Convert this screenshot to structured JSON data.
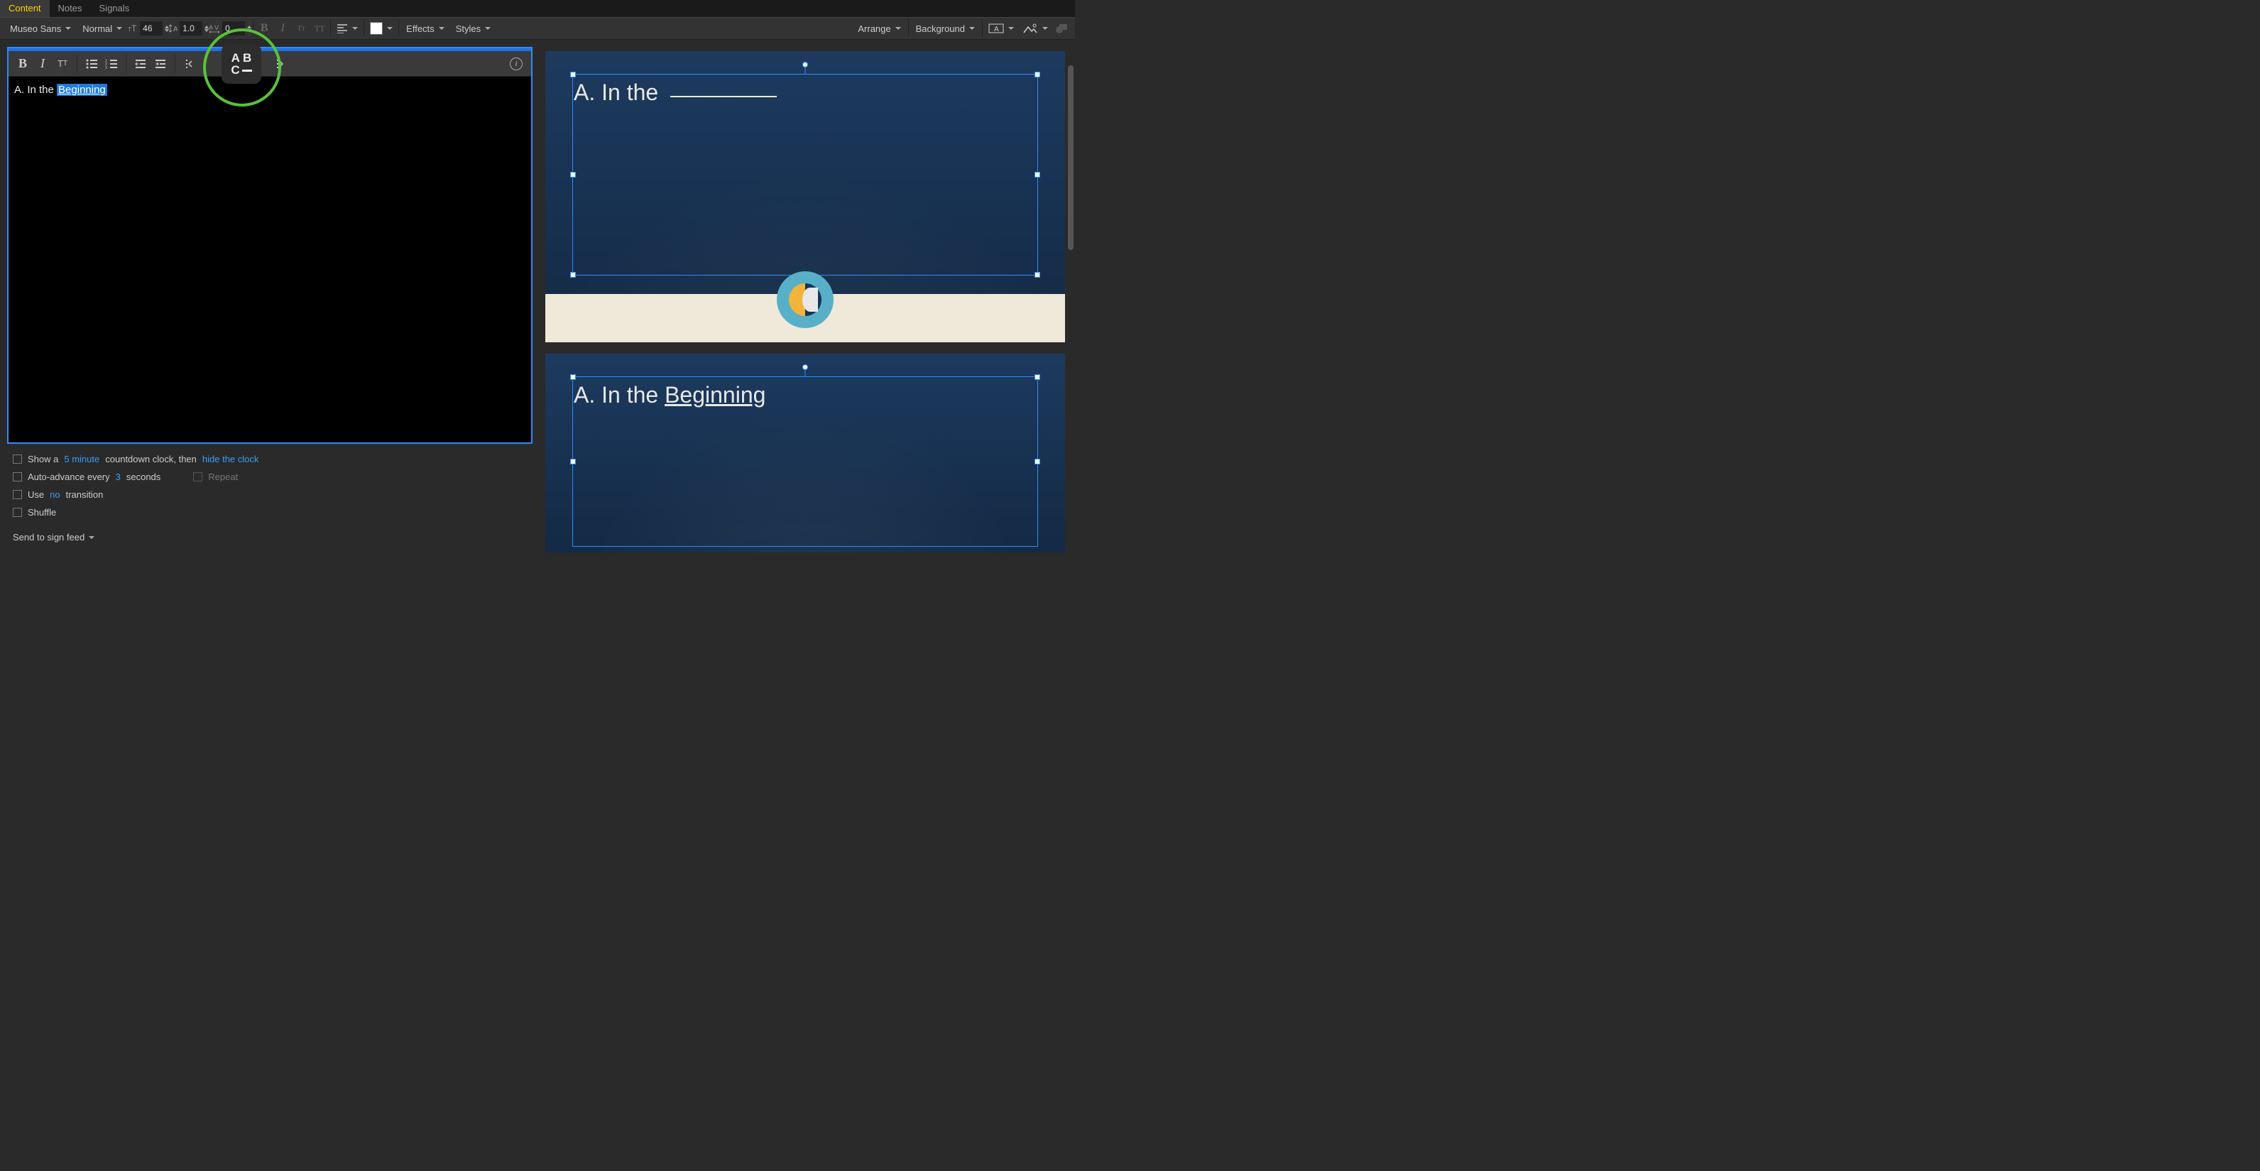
{
  "tabs": {
    "content": "Content",
    "notes": "Notes",
    "signals": "Signals"
  },
  "toolbar": {
    "font": "Museo Sans",
    "weight": "Normal",
    "size": "46",
    "lineHeight": "1.0",
    "tracking": "0",
    "effects": "Effects",
    "styles": "Styles",
    "arrange": "Arrange",
    "background": "Background"
  },
  "editor": {
    "abc_top": "A B",
    "abc_bottom": "C",
    "text_prefix": "A. In the ",
    "text_selected": " Beginning "
  },
  "options": {
    "show_a": "Show a",
    "five_min": "5 minute",
    "countdown_then": "countdown clock, then",
    "hide_clock": "hide the clock",
    "auto_adv": "Auto-advance every",
    "three": "3",
    "seconds": "seconds",
    "repeat": "Repeat",
    "use": "Use",
    "no": "no",
    "transition": "transition",
    "shuffle": "Shuffle",
    "send": "Send to sign feed"
  },
  "preview": {
    "slide1_text": "A. In the",
    "slide2_prefix": "A. In the ",
    "slide2_underlined": "Beginning"
  }
}
